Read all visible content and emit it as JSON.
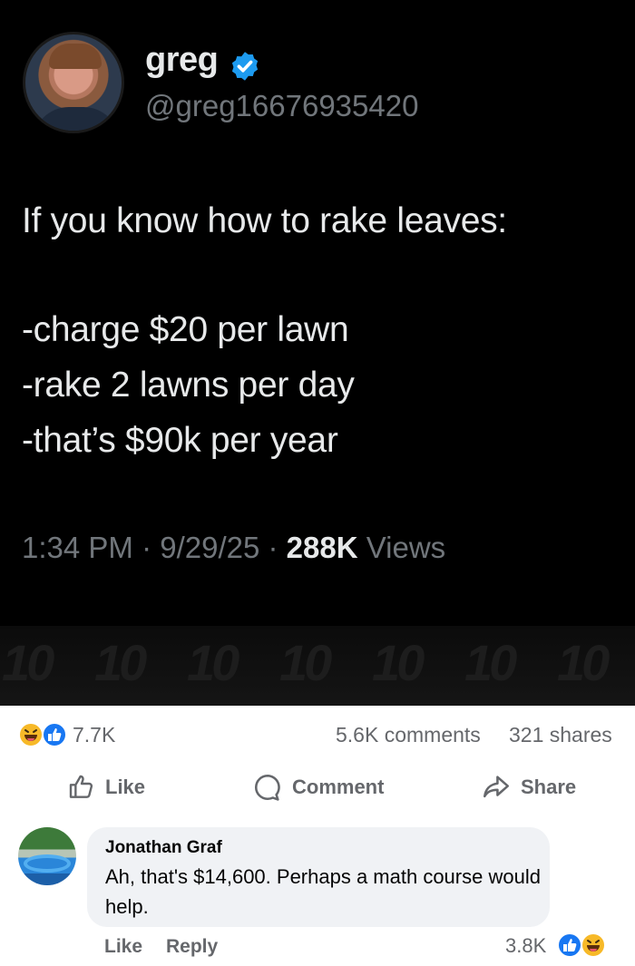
{
  "tweet": {
    "display_name": "greg",
    "handle": "@greg16676935420",
    "lines": [
      "If you know how to rake leaves:",
      "-charge $20 per lawn",
      "-rake 2 lawns per day",
      "-that’s $90k per year"
    ],
    "time_date": "1:34 PM · 9/29/25 · ",
    "views_count": "288K",
    "views_label": " Views",
    "watermark": "10",
    "colors": {
      "background": "#000000",
      "text": "#e7e9ea",
      "muted": "#71767b",
      "verified": "#1d9bf0"
    }
  },
  "post": {
    "reactions_count": "7.7K",
    "reaction_icons": [
      "haha-icon",
      "like-icon"
    ],
    "comments_label": "5.6K comments",
    "shares_label": "321 shares",
    "actions": {
      "like": "Like",
      "comment": "Comment",
      "share": "Share"
    },
    "colors": {
      "muted": "#65676b",
      "like_blue": "#1877f2",
      "haha_yellow": "#f7b928"
    }
  },
  "comment": {
    "author": "Jonathan Graf",
    "text": "Ah, that's $14,600. Perhaps a math course would help.",
    "like_label": "Like",
    "reply_label": "Reply",
    "reaction_count": "3.8K",
    "reaction_icons": [
      "like-icon",
      "haha-icon"
    ]
  }
}
